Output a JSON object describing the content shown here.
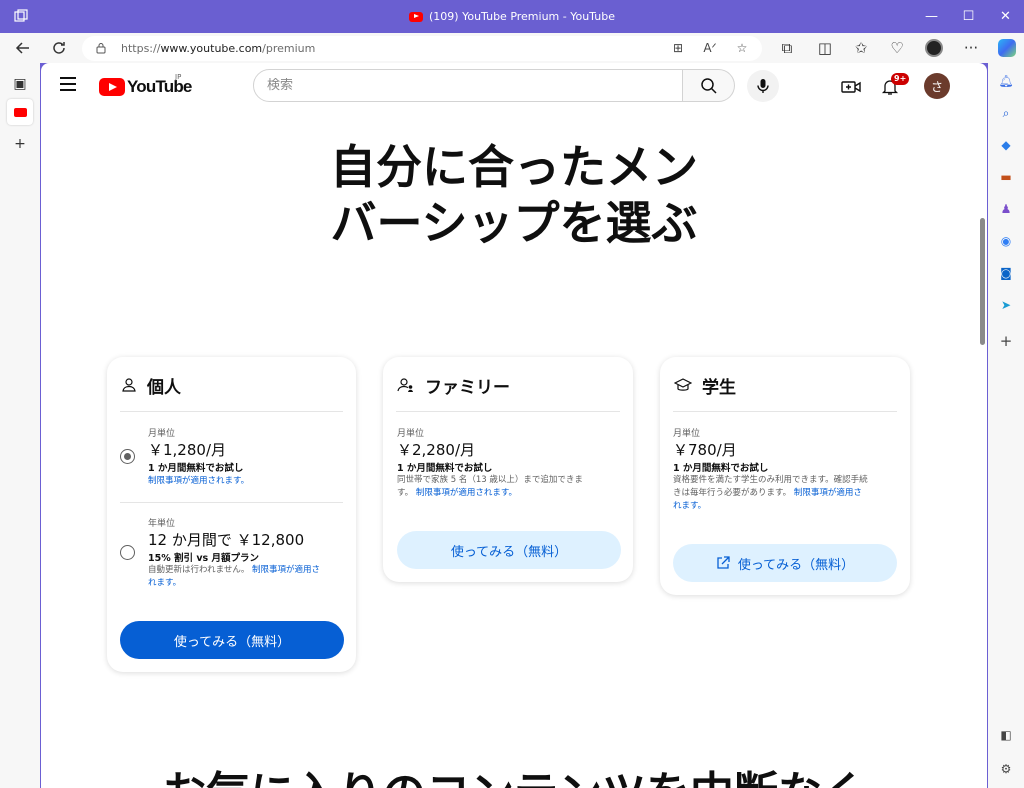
{
  "window": {
    "title": "(109) YouTube Premium - YouTube",
    "controls": {
      "minimize": "—",
      "maximize": "☐",
      "close": "✕"
    }
  },
  "browser": {
    "url_prefix": "https://",
    "url_host": "www.youtube.com",
    "url_path": "/premium",
    "accent": "#6a5fd1"
  },
  "youtube": {
    "logo_text": "YouTube",
    "region": "JP",
    "search_placeholder": "検索",
    "notification_count": "9+",
    "avatar_initial": "さ"
  },
  "hero": {
    "line1": "自分に合ったメン",
    "line2": "バーシップを選ぶ"
  },
  "plans": {
    "individual": {
      "name": "個人",
      "monthly": {
        "label": "月単位",
        "price": "￥1,280/月",
        "trial": "1 か月間無料でお試し",
        "restrictions": "制限事項が適用されます。",
        "selected": true
      },
      "annual": {
        "label": "年単位",
        "price": "12 か月間で ￥12,800",
        "discount": "15% 割引 vs 月額プラン",
        "note": "自動更新は行われません。",
        "restrictions_a": "制限事項が適用さ",
        "restrictions_b": "れます。",
        "selected": false
      },
      "cta": "使ってみる（無料）"
    },
    "family": {
      "name": "ファミリー",
      "label": "月単位",
      "price": "￥2,280/月",
      "trial": "1 か月間無料でお試し",
      "desc_a": "同世帯で家族 5 名（13 歳以上）まで追加できま",
      "desc_b": "す。",
      "restrictions": "制限事項が適用されます。",
      "cta": "使ってみる（無料）"
    },
    "student": {
      "name": "学生",
      "label": "月単位",
      "price": "￥780/月",
      "trial": "1 か月間無料でお試し",
      "desc_a": "資格要件を満たす学生のみ利用できます。確認手続",
      "desc_b": "きは毎年行う必要があります。",
      "restrictions_a": "制限事項が適用さ",
      "restrictions_b": "れます。",
      "cta": "使ってみる（無料）"
    }
  },
  "bottom_heading": "お気に入りのコンテンツを中断なく"
}
